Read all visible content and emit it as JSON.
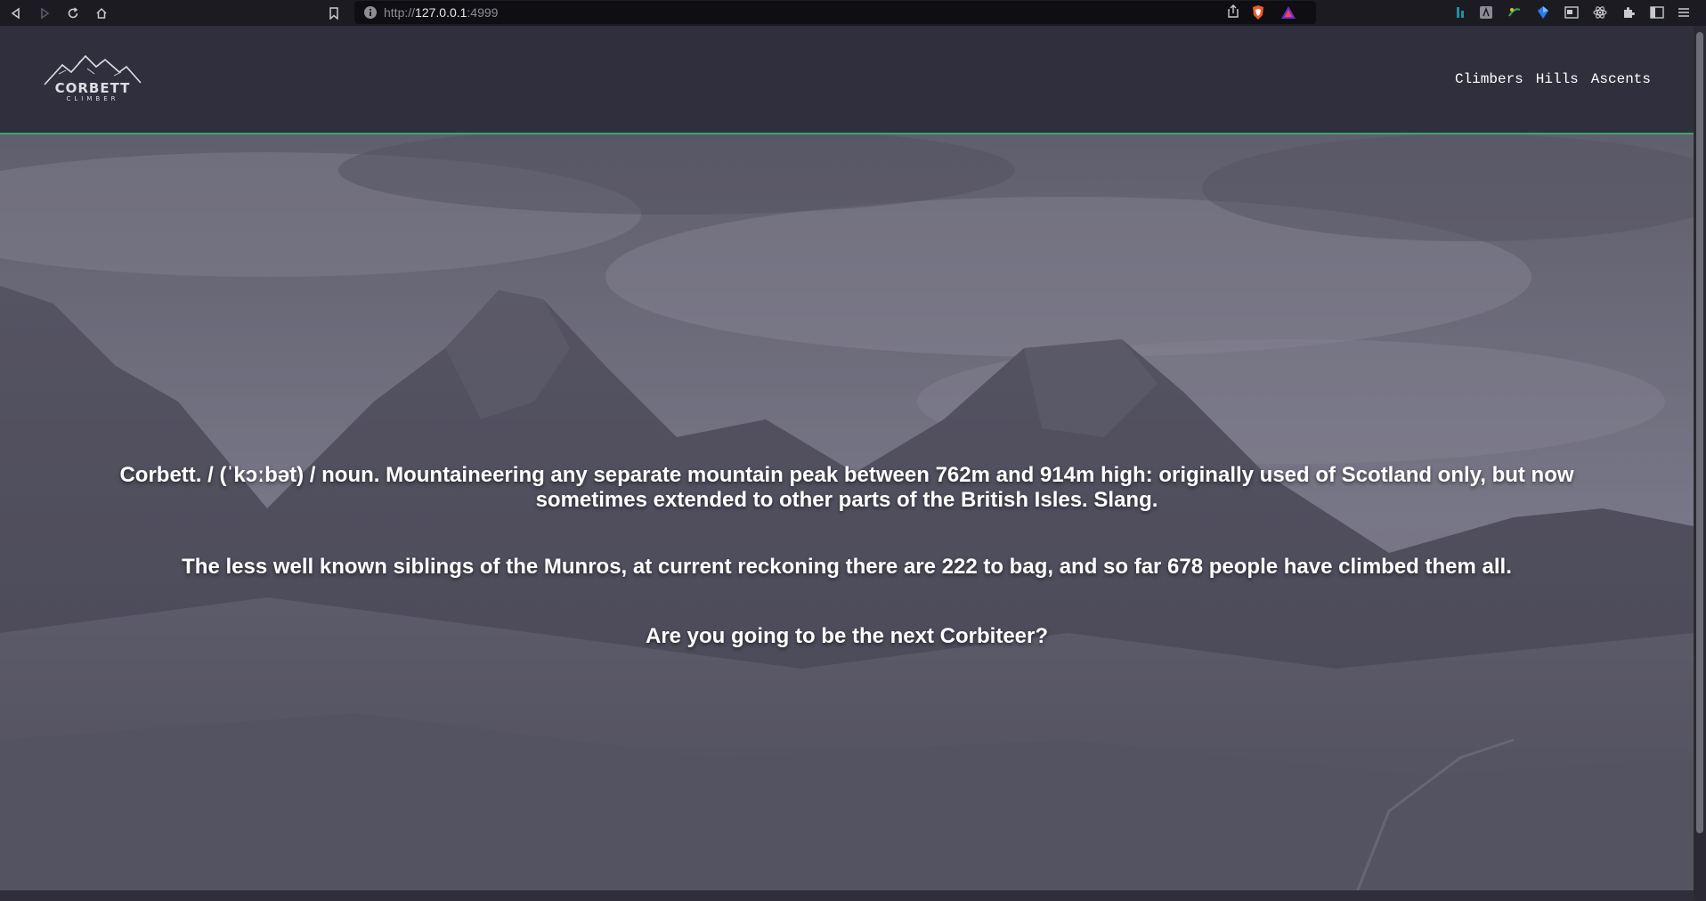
{
  "browser": {
    "url_scheme": "http://",
    "url_host": "127.0.0.1",
    "url_port": ":4999"
  },
  "site": {
    "logo": {
      "main": "CORBETT",
      "sub": "CLIMBER"
    },
    "nav": [
      {
        "label": "Climbers"
      },
      {
        "label": "Hills"
      },
      {
        "label": "Ascents"
      }
    ]
  },
  "hero": {
    "definition": "Corbett. / (ˈkɔːbət) / noun. Mountaineering any separate mountain peak between 762m and 914m high: originally used of Scotland only, but now sometimes extended to other parts of the British Isles. Slang.",
    "intro": "The less well known siblings of the Munros, at current reckoning there are 222 to bag, and so far 678 people have climbed them all.",
    "cta": "Are you going to be the next Corbiteer?"
  },
  "colors": {
    "header_bg": "#302f3d",
    "header_border": "#39a56a",
    "browser_bg": "#1c1b22"
  }
}
